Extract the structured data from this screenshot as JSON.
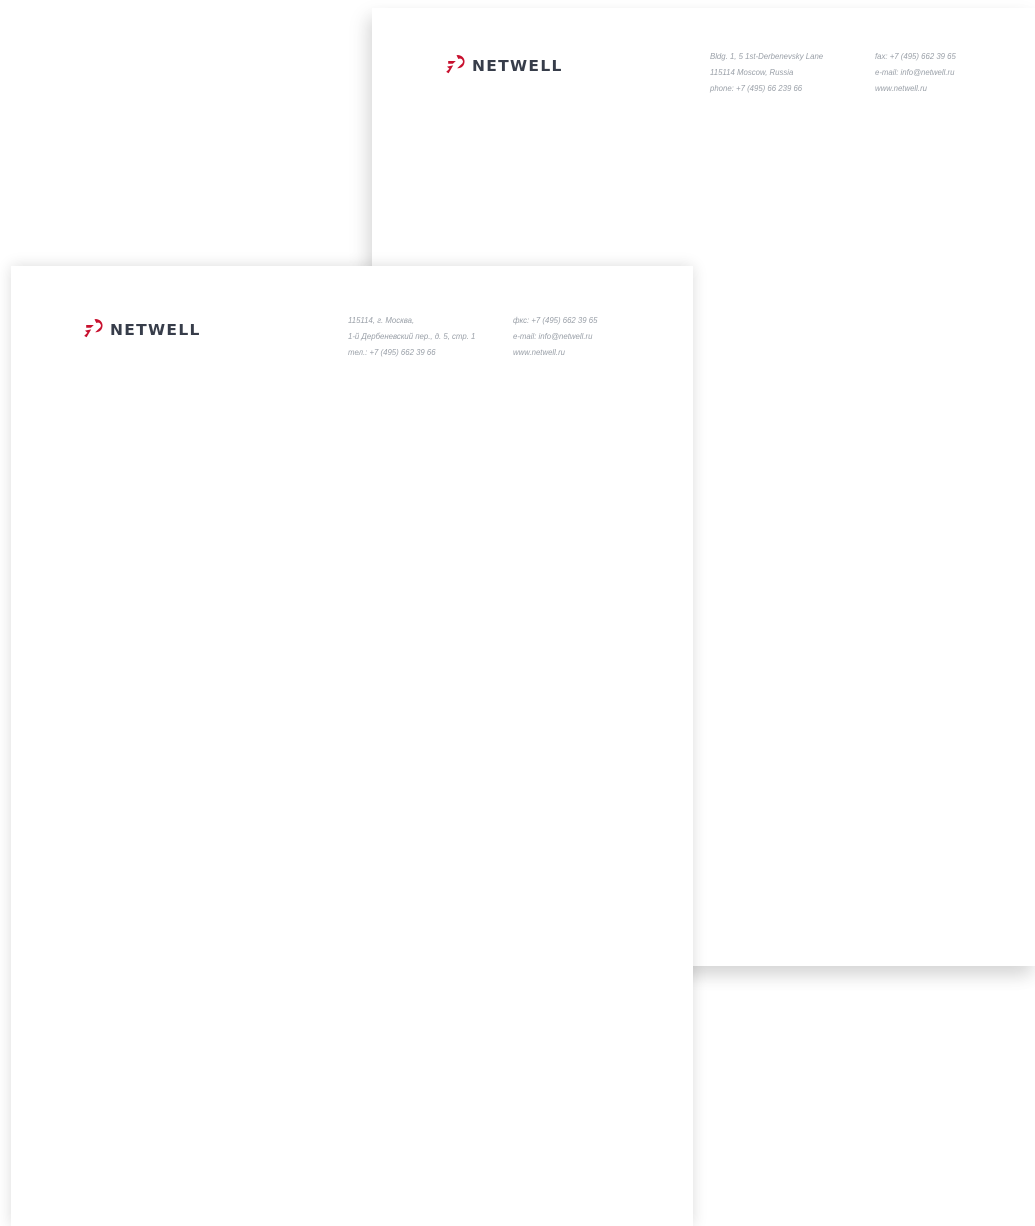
{
  "colors": {
    "brand_red": "#c8102e",
    "brand_dark": "#373d4a",
    "info_text": "#9aa0a8"
  },
  "icons": {
    "logo_mark": "netwell-logo-icon"
  },
  "letterhead_en": {
    "logo_text": "NETWELL",
    "address_lines": [
      "Bldg. 1, 5 1st-Derbenevsky Lane",
      "115114 Moscow, Russia",
      "phone: +7 (495) 66 239 66"
    ],
    "contact_lines": [
      "fax: +7 (495) 662 39 65",
      "e-mail: info@netwell.ru",
      "www.netwell.ru"
    ]
  },
  "letterhead_ru": {
    "logo_text": "NETWELL",
    "address_lines": [
      "115114, г. Москва,",
      "1-й Дербеневский пер., д. 5, стр. 1",
      "тел.: +7 (495) 662 39 66"
    ],
    "contact_lines": [
      "фкс: +7 (495) 662 39 65",
      "e-mail: info@netwell.ru",
      "www.netwell.ru"
    ]
  }
}
